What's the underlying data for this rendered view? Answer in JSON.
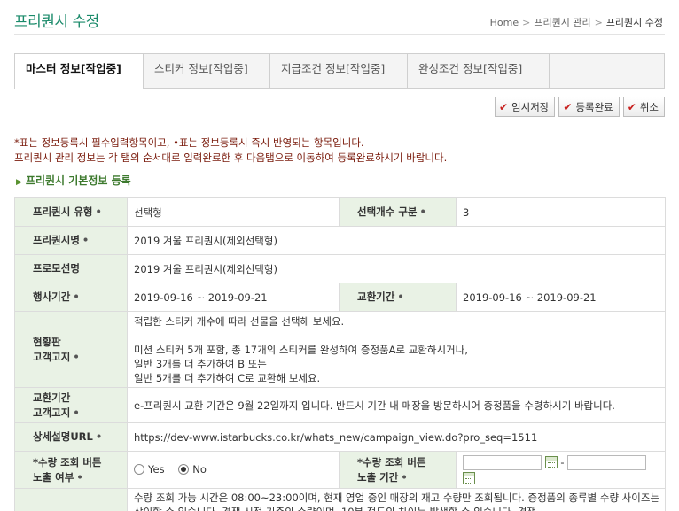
{
  "header": {
    "title": "프리퀀시 수정",
    "breadcrumb": [
      "Home",
      "프리퀀시 관리",
      "프리퀀시 수정"
    ]
  },
  "tabs": [
    {
      "label": "마스터 정보[작업중]",
      "active": true
    },
    {
      "label": "스티커 정보[작업중]",
      "active": false
    },
    {
      "label": "지급조건 정보[작업중]",
      "active": false
    },
    {
      "label": "완성조건 정보[작업중]",
      "active": false
    }
  ],
  "buttons": {
    "temp_save": "임시저장",
    "complete": "등록완료",
    "cancel": "취소"
  },
  "notice": {
    "line1": "*표는 정보등록시 필수입력항목이고, •표는 정보등록시 즉시 반영되는 항목입니다.",
    "line2": "프리퀀시 관리 정보는 각 탭의 순서대로 입력완료한 후 다음탭으로 이동하여 등록완료하시기 바랍니다."
  },
  "section": {
    "title": "프리퀀시 기본정보 등록"
  },
  "form": {
    "type_label": "프리퀀시 유형",
    "type_value": "선택형",
    "select_count_label": "선택개수 구분",
    "select_count_value": "3",
    "name_label": "프리퀀시명",
    "name_value": "2019 겨울 프리퀀시(제외선택형)",
    "promo_label": "프로모션명",
    "promo_value": "2019 겨울 프리퀀시(제외선택형)",
    "event_period_label": "행사기간",
    "event_period_value": "2019-09-16 ~ 2019-09-21",
    "exchange_period_label": "교환기간",
    "exchange_period_value": "2019-09-16 ~ 2019-09-21",
    "board_notice_label_1": "현황판",
    "board_notice_label_2": "고객고지",
    "board_notice_value": "적립한 스티커 개수에 따라 선물을 선택해 보세요.\n\n미션 스티커 5개 포함, 총 17개의 스티커를 완성하여 증정품A로 교환하시거나,\n일반 3개를 더 추가하여 B 또는\n일반 5개를 더 추가하여 C로 교환해 보세요.",
    "exchange_notice_label_1": "교환기간",
    "exchange_notice_label_2": "고객고지",
    "exchange_notice_value": "e-프리퀀시 교환 기간은 9월 22일까지 입니다. 반드시 기간 내 매장을 방문하시어 증정품을 수령하시기 바랍니다.",
    "detail_url_label": "상세설명URL",
    "detail_url_value": "https://dev-www.istarbucks.co.kr/whats_new/campaign_view.do?pro_seq=1511",
    "qty_button_label_1": "*수량 조회 버튼",
    "qty_button_label_2": "노출 여부",
    "qty_yes": "Yes",
    "qty_no": "No",
    "qty_selected": "No",
    "qty_period_label_1": "*수량 조회 버튼",
    "qty_period_label_2": "노출 기간",
    "date_separator": "-",
    "qty_notice_value": "수량 조회 가능 시간은 08:00~23:00이며, 현재 영업 중인 매장의 재고 수량만 조회됩니다. 증정품의 종류별 수량 사이즈는 상이할 수 있습니다. 경쟁 시점 기준의 수량이며, 10분 정도의 차이는 발생할 수 있습니다. 경쟁"
  },
  "colors": {
    "title_green": "#1a8a6a",
    "label_bg": "#e9f2e5",
    "notice_red": "#7a1b0c",
    "section_green": "#3d7a2e",
    "check_red": "#c8201e"
  }
}
